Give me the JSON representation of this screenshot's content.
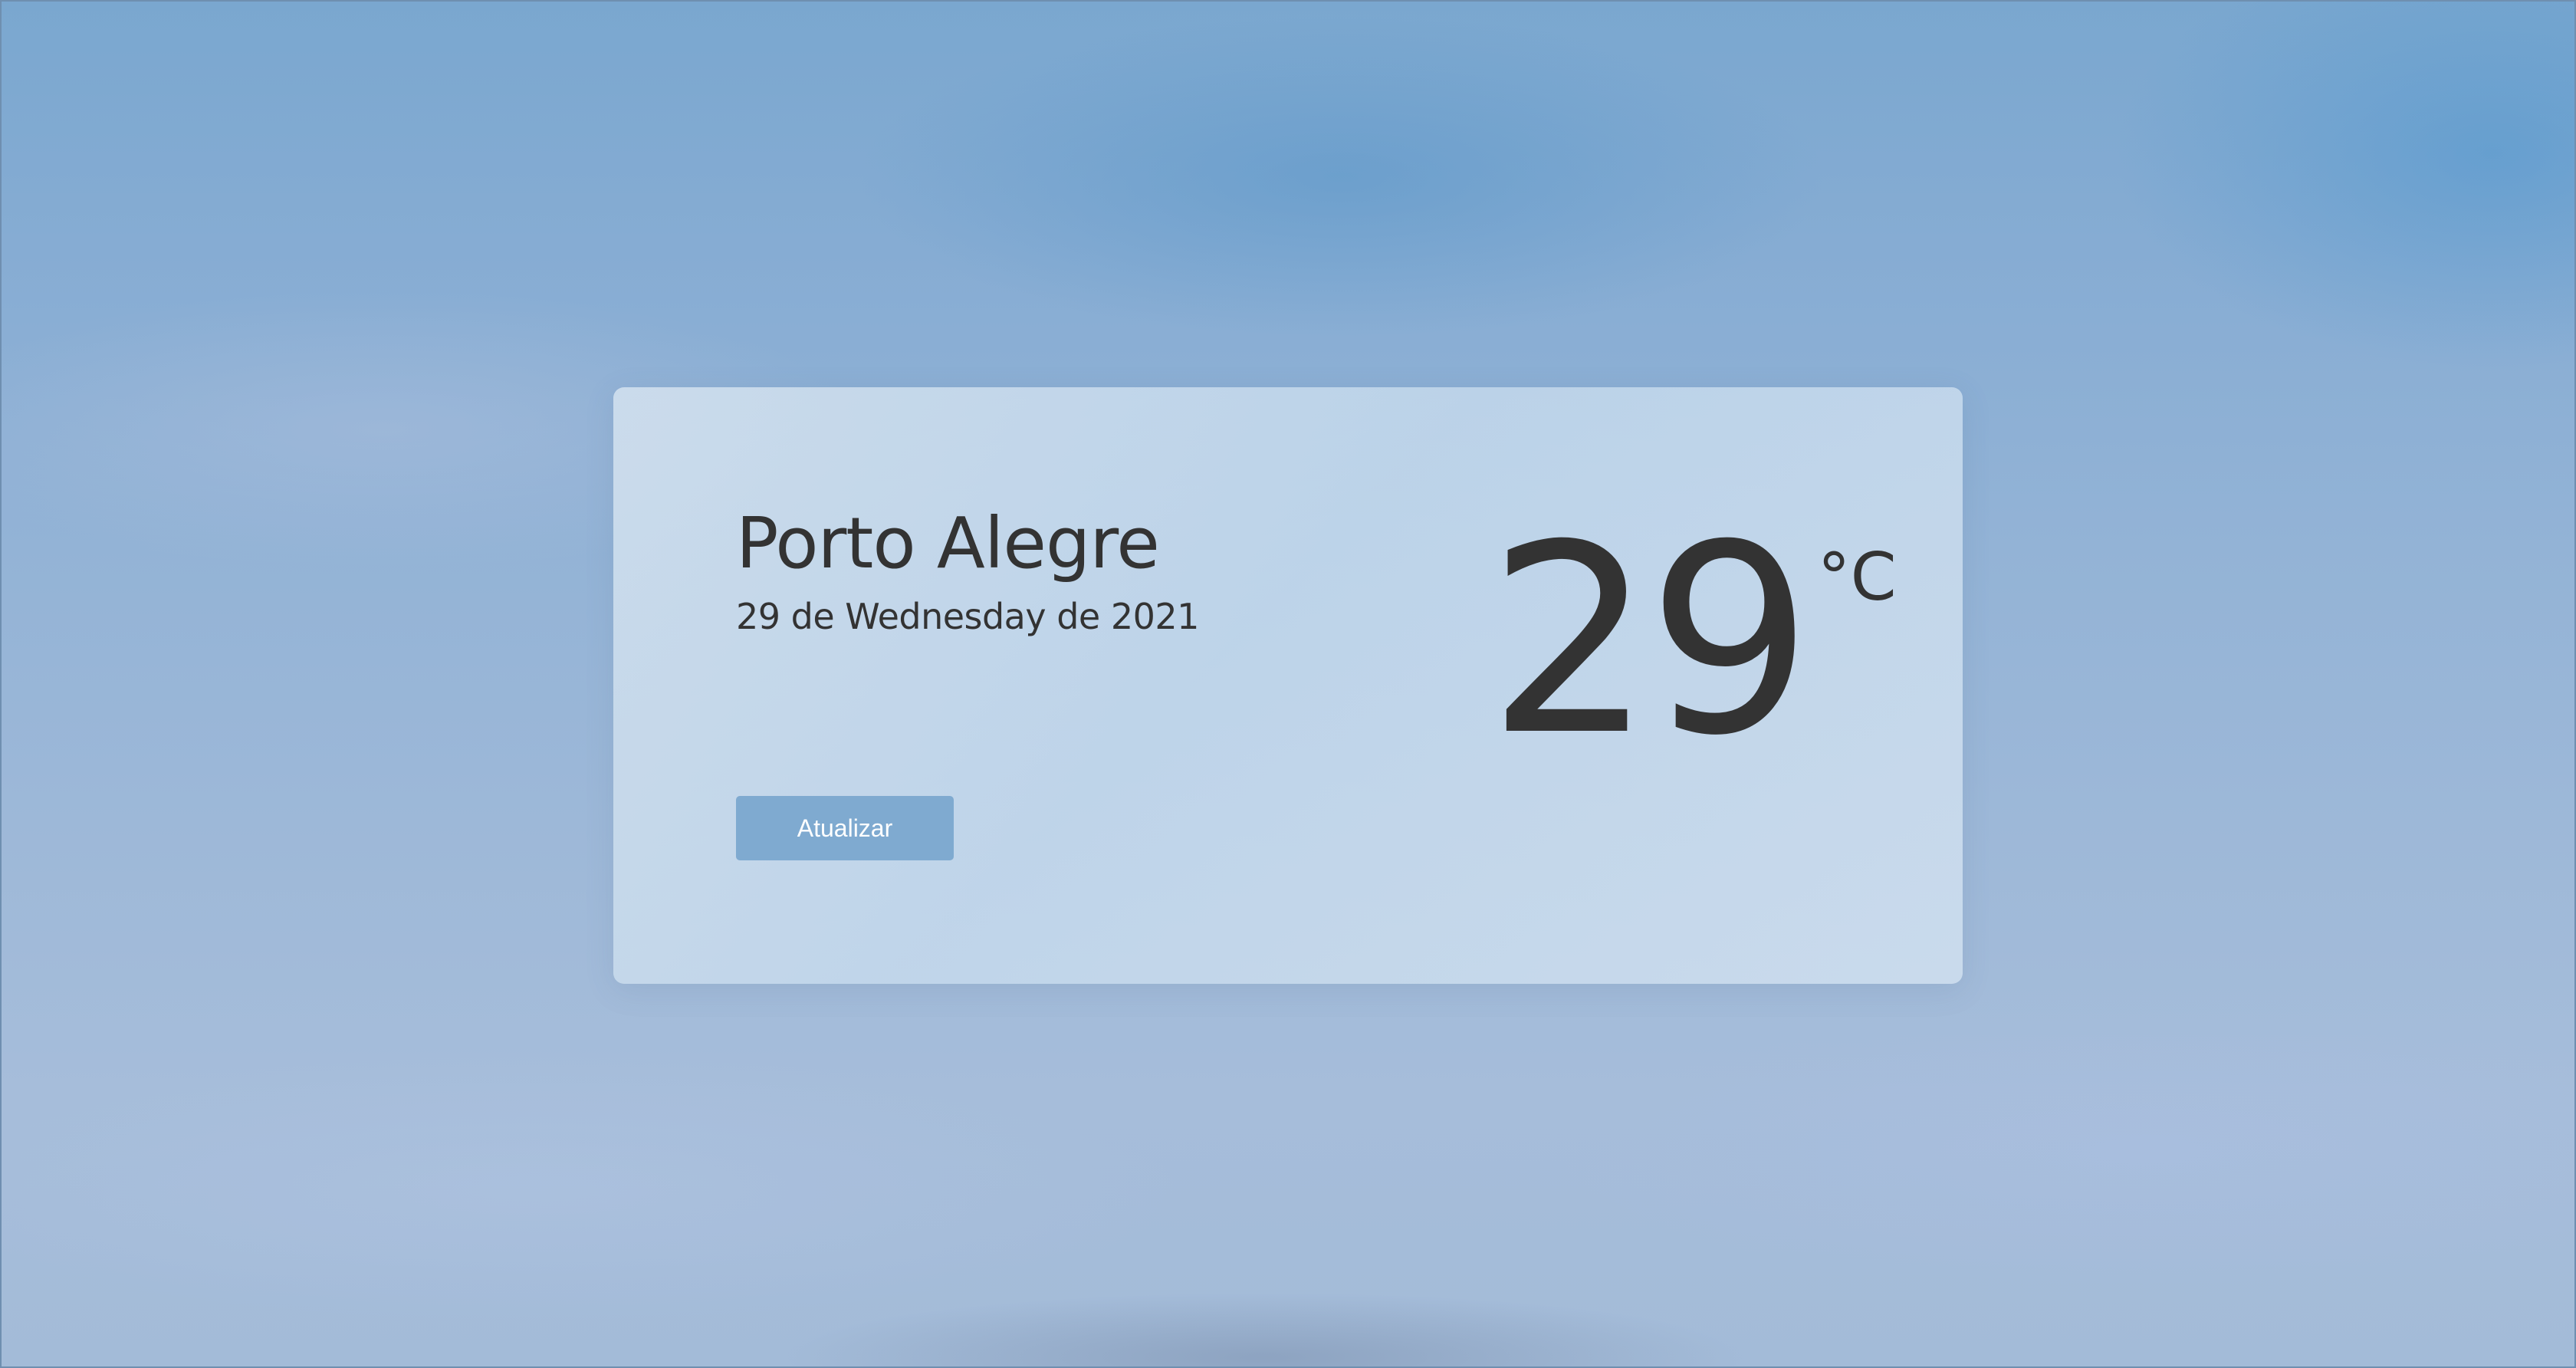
{
  "weather": {
    "city": "Porto Alegre",
    "date": "29 de Wednesday de 2021",
    "temperature": "29",
    "unit": "°C"
  },
  "actions": {
    "refresh_label": "Atualizar"
  },
  "colors": {
    "background_top": "#7aa7cf",
    "background_bottom": "#a3bbd8",
    "card_background": "#c9dbeb",
    "text_primary": "#333333",
    "button_background": "#7faad0",
    "button_text": "#ffffff"
  }
}
